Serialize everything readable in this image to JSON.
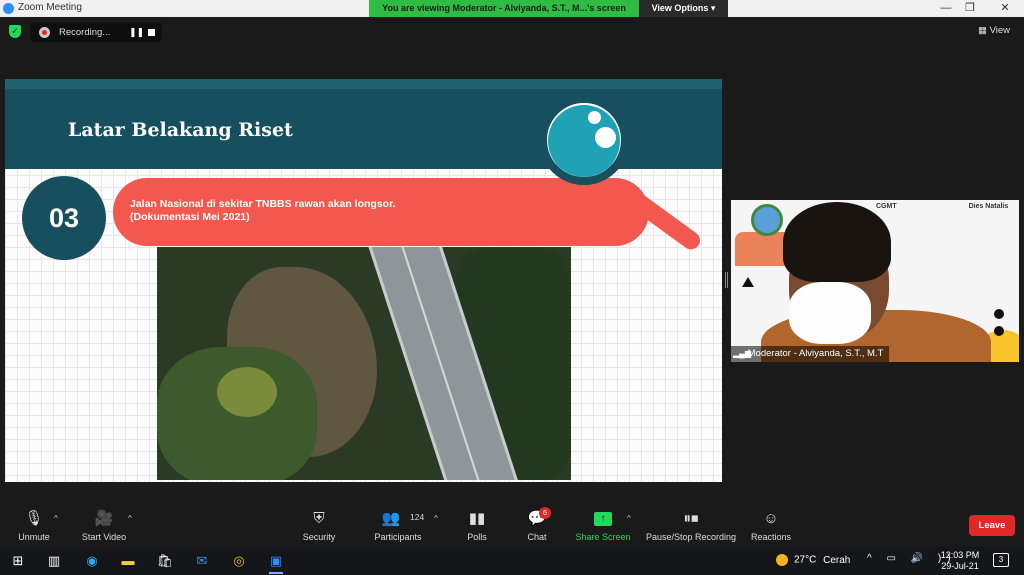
{
  "window": {
    "title": "Zoom Meeting",
    "viewing_banner": "You are viewing Moderator - Alviyanda, S.T., M...'s screen",
    "view_options": "View Options ▾",
    "minimize": "—",
    "maximize": "❐",
    "close": "✕"
  },
  "meeting_bar": {
    "recording_label": "Recording...",
    "pause_icon": "❚❚",
    "view_label": "▦ View"
  },
  "slide": {
    "title": "Latar Belakang Riset",
    "point_number": "03",
    "point_text": "Jalan Nasional di sekitar TNBBS rawan akan longsor. (Dokumentasi Mei 2021)"
  },
  "video": {
    "participant_name": "Moderator - Alviyanda, S.T., M.T",
    "logo_strip": "CGMT",
    "logo_tail": "Dies Natalis",
    "signal_icon": "▂▄▆"
  },
  "toolbar": {
    "unmute": "Unmute",
    "start_video": "Start Video",
    "security": "Security",
    "participants": "Participants",
    "participant_count": "124",
    "polls": "Polls",
    "chat": "Chat",
    "chat_badge": "6",
    "share_screen": "Share Screen",
    "pause_stop_recording": "Pause/Stop Recording",
    "reactions": "Reactions",
    "leave": "Leave",
    "caret": "^"
  },
  "taskbar": {
    "weather_temp": "27°C",
    "weather_text": "Cerah",
    "time": "12:03 PM",
    "date": "29-Jul-21",
    "notifications": "3",
    "tray_icons": "^ ▭ 🔊 ))"
  },
  "colors": {
    "zoom_green": "#23d959",
    "banner_green": "#2fbc42",
    "slide_teal": "#174f5f",
    "slide_coral": "#f2584d",
    "lens": "#1fa3b4",
    "leave_red": "#e02828"
  }
}
